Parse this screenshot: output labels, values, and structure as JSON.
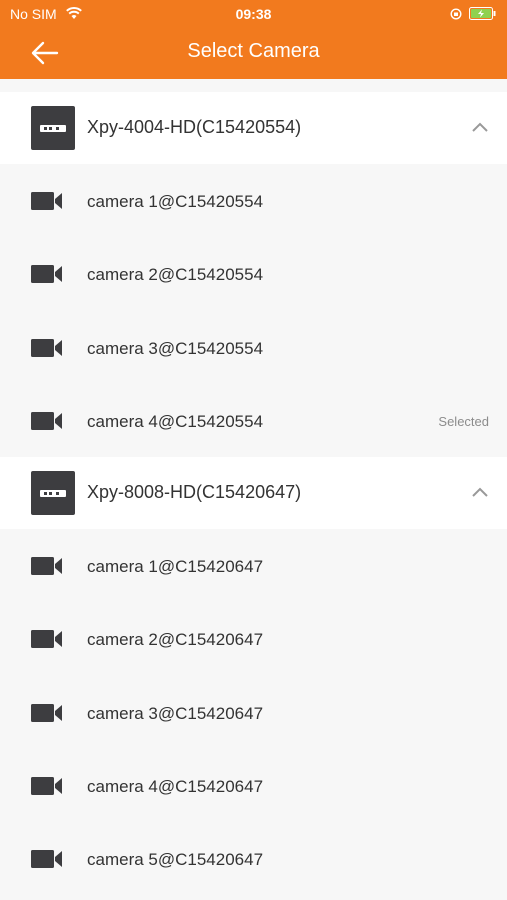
{
  "status_bar": {
    "carrier": "No SIM",
    "time": "09:38"
  },
  "header": {
    "title": "Select Camera"
  },
  "devices": [
    {
      "name": "Xpy-4004-HD(C15420554)",
      "cameras": [
        {
          "label": "camera 1@C15420554",
          "status": ""
        },
        {
          "label": "camera 2@C15420554",
          "status": ""
        },
        {
          "label": "camera 3@C15420554",
          "status": ""
        },
        {
          "label": "camera 4@C15420554",
          "status": "Selected"
        }
      ]
    },
    {
      "name": "Xpy-8008-HD(C15420647)",
      "cameras": [
        {
          "label": "camera 1@C15420647",
          "status": ""
        },
        {
          "label": "camera 2@C15420647",
          "status": ""
        },
        {
          "label": "camera 3@C15420647",
          "status": ""
        },
        {
          "label": "camera 4@C15420647",
          "status": ""
        },
        {
          "label": "camera 5@C15420647",
          "status": ""
        }
      ]
    }
  ],
  "colors": {
    "accent": "#f27a1e",
    "device_icon": "#3d3d40"
  },
  "icons": {
    "back": "back-arrow-icon",
    "device": "dvr-icon",
    "camera": "video-camera-icon",
    "collapse": "chevron-up-icon"
  }
}
